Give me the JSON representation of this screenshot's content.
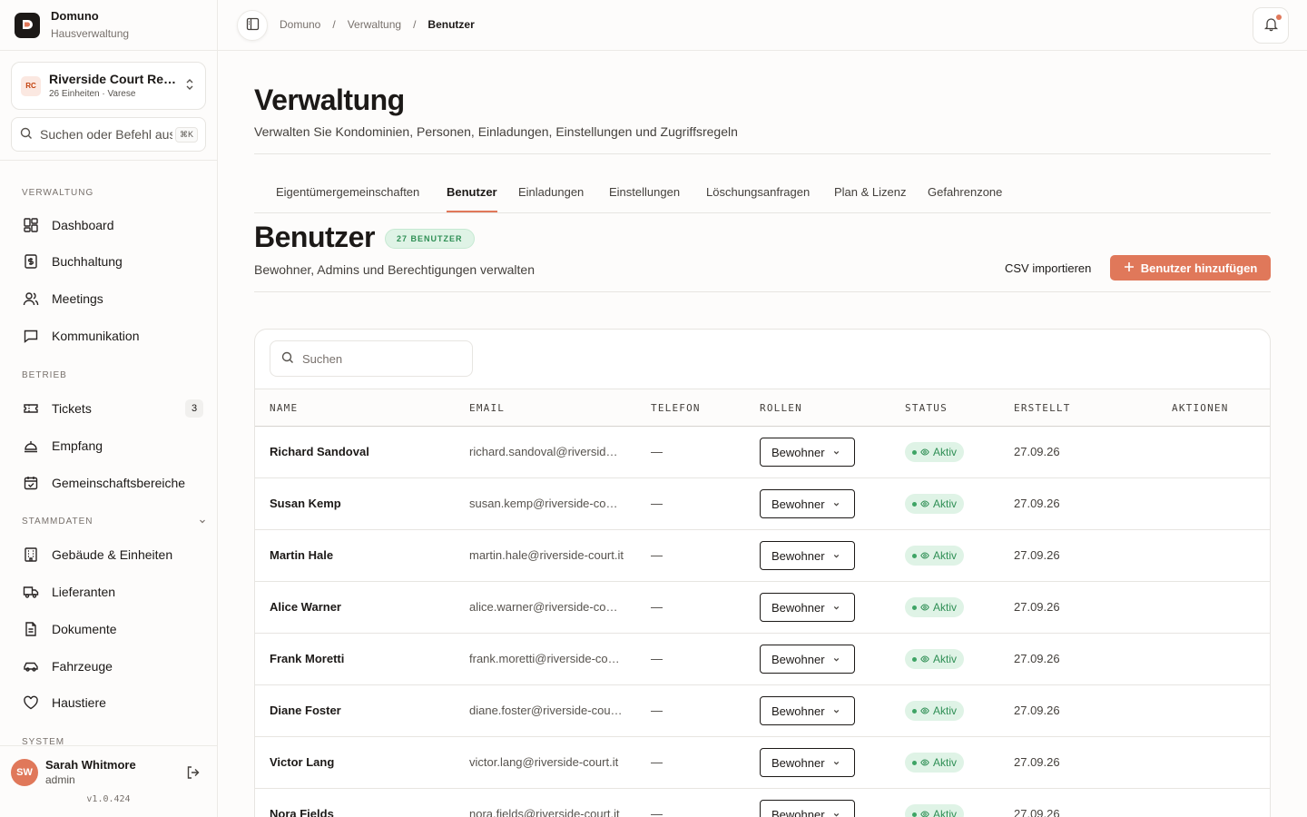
{
  "brand": {
    "name": "Domuno",
    "subtitle": "Hausverwaltung"
  },
  "property": {
    "initials": "RC",
    "name": "Riverside Court Residences",
    "meta": "26 Einheiten · Varese"
  },
  "sidebar_search": {
    "placeholder": "Suchen oder Befehl ausführen",
    "shortcut": "⌘K"
  },
  "nav": {
    "section_verwaltung": "VERWALTUNG",
    "dashboard": "Dashboard",
    "buchhaltung": "Buchhaltung",
    "meetings": "Meetings",
    "kommunikation": "Kommunikation",
    "section_betrieb": "BETRIEB",
    "tickets": "Tickets",
    "tickets_count": "3",
    "empfang": "Empfang",
    "gemeinschaftsbereiche": "Gemeinschaftsbereiche",
    "section_stammdaten": "STAMMDATEN",
    "gebaeude": "Gebäude & Einheiten",
    "lieferanten": "Lieferanten",
    "dokumente": "Dokumente",
    "fahrzeuge": "Fahrzeuge",
    "haustiere": "Haustiere",
    "section_system": "SYSTEM"
  },
  "user": {
    "initials": "SW",
    "name": "Sarah Whitmore",
    "role": "admin",
    "version": "v1.0.424"
  },
  "breadcrumb": {
    "root": "Domuno",
    "middle": "Verwaltung",
    "current": "Benutzer",
    "separator": "/"
  },
  "page": {
    "title": "Verwaltung",
    "subtitle": "Verwalten Sie Kondominien, Personen, Einladungen, Einstellungen und Zugriffsregeln"
  },
  "tabs": {
    "t1": "Eigentümergemeinschaften",
    "t2": "Benutzer",
    "t3": "Einladungen",
    "t4": "Einstellungen",
    "t5": "Löschungsanfragen",
    "t6": "Plan & Lizenz",
    "t7": "Gefahrenzone"
  },
  "section": {
    "title": "Benutzer",
    "badge": "27 BENUTZER",
    "subtitle": "Bewohner, Admins und Berechtigungen verwalten",
    "csv_label": "CSV importieren",
    "add_label": "Benutzer hinzufügen"
  },
  "table": {
    "search_placeholder": "Suchen",
    "headers": {
      "name": "NAME",
      "email": "EMAIL",
      "phone": "TELEFON",
      "roles": "ROLLEN",
      "status": "STATUS",
      "created": "ERSTELLT",
      "actions": "AKTIONEN"
    },
    "rows": [
      {
        "name": "Richard Sandoval",
        "email": "richard.sandoval@riverside-court.it",
        "phone": "—",
        "role": "Bewohner",
        "status": "Aktiv",
        "created": "27.09.26"
      },
      {
        "name": "Susan Kemp",
        "email": "susan.kemp@riverside-court.it",
        "phone": "—",
        "role": "Bewohner",
        "status": "Aktiv",
        "created": "27.09.26"
      },
      {
        "name": "Martin Hale",
        "email": "martin.hale@riverside-court.it",
        "phone": "—",
        "role": "Bewohner",
        "status": "Aktiv",
        "created": "27.09.26"
      },
      {
        "name": "Alice Warner",
        "email": "alice.warner@riverside-court.it",
        "phone": "—",
        "role": "Bewohner",
        "status": "Aktiv",
        "created": "27.09.26"
      },
      {
        "name": "Frank Moretti",
        "email": "frank.moretti@riverside-court.it",
        "phone": "—",
        "role": "Bewohner",
        "status": "Aktiv",
        "created": "27.09.26"
      },
      {
        "name": "Diane Foster",
        "email": "diane.foster@riverside-court.it",
        "phone": "—",
        "role": "Bewohner",
        "status": "Aktiv",
        "created": "27.09.26"
      },
      {
        "name": "Victor Lang",
        "email": "victor.lang@riverside-court.it",
        "phone": "—",
        "role": "Bewohner",
        "status": "Aktiv",
        "created": "27.09.26"
      },
      {
        "name": "Nora Fields",
        "email": "nora.fields@riverside-court.it",
        "phone": "—",
        "role": "Bewohner",
        "status": "Aktiv",
        "created": "27.09.26"
      }
    ]
  },
  "colors": {
    "accent": "#e0785a",
    "success": "#2f8f55",
    "success_bg": "#dff3e6"
  }
}
